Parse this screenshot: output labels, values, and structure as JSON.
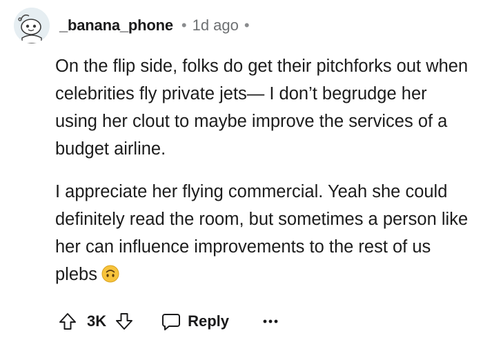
{
  "comment": {
    "username": "_banana_phone",
    "separator": "•",
    "timestamp": "1d ago",
    "paragraphs": [
      "On the flip side, folks do get their pitchforks out when celebrities fly private jets— I don’t begrudge her using her clout to maybe improve the services of a budget airline.",
      "I appreciate her flying commercial. Yeah she could definitely read the room, but sometimes a person like her can influence improvements to the rest of us plebs"
    ],
    "emoji": "upside-down-face-emoji"
  },
  "actions": {
    "upvote_icon": "arrow-up-icon",
    "vote_count": "3K",
    "downvote_icon": "arrow-down-icon",
    "reply_icon": "speech-bubble-icon",
    "reply_label": "Reply",
    "more_icon": "ellipsis-icon"
  },
  "colors": {
    "text": "#1c1c1c",
    "meta": "#6d7072",
    "avatar_bg": "#e6eef2",
    "emoji_fill": "#f7c33c"
  }
}
